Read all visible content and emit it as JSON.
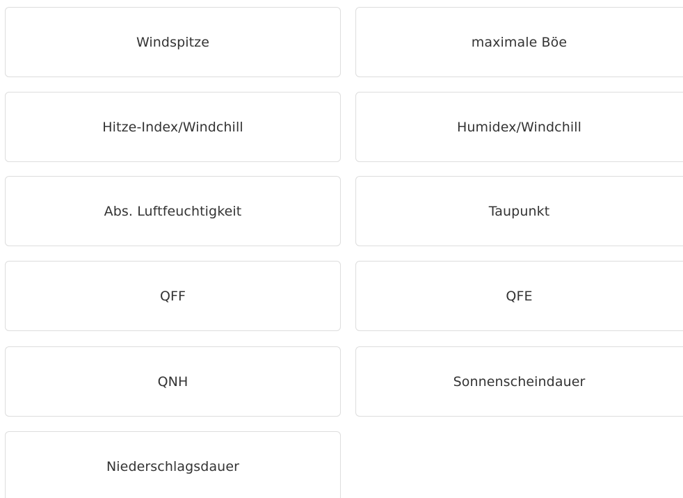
{
  "tiles": [
    {
      "label": "Windspitze"
    },
    {
      "label": "maximale Böe"
    },
    {
      "label": "Hitze-Index/Windchill"
    },
    {
      "label": "Humidex/Windchill"
    },
    {
      "label": "Abs. Luftfeuchtigkeit"
    },
    {
      "label": "Taupunkt"
    },
    {
      "label": "QFF"
    },
    {
      "label": "QFE"
    },
    {
      "label": "QNH"
    },
    {
      "label": "Sonnenscheindauer"
    },
    {
      "label": "Niederschlagsdauer"
    }
  ]
}
